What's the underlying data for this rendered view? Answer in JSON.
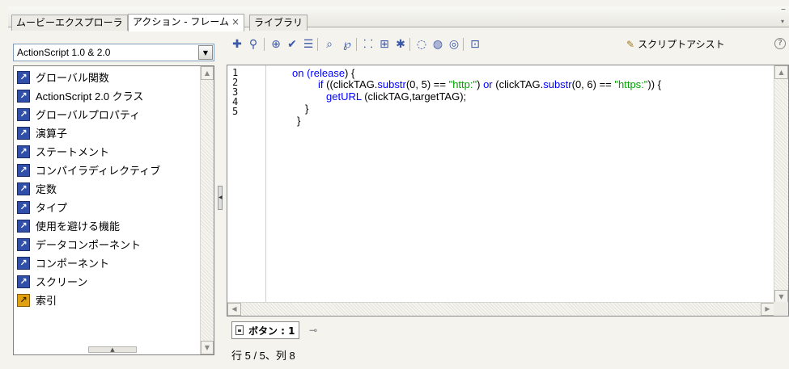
{
  "tabs": [
    {
      "label": "ムービーエクスプローラ",
      "active": false
    },
    {
      "label": "アクション - フレーム",
      "active": true,
      "close": "×"
    },
    {
      "label": "ライブラリ",
      "active": false
    }
  ],
  "left_panel": {
    "language_select": "ActionScript 1.0 & 2.0",
    "tree_items": [
      {
        "label": "グローバル関数",
        "icon": "book-icon"
      },
      {
        "label": "ActionScript 2.0 クラス",
        "icon": "book-icon"
      },
      {
        "label": "グローバルプロパティ",
        "icon": "book-icon"
      },
      {
        "label": "演算子",
        "icon": "book-icon"
      },
      {
        "label": "ステートメント",
        "icon": "book-icon"
      },
      {
        "label": "コンパイラディレクティブ",
        "icon": "book-icon"
      },
      {
        "label": "定数",
        "icon": "book-icon"
      },
      {
        "label": "タイプ",
        "icon": "book-icon"
      },
      {
        "label": "使用を避ける機能",
        "icon": "book-icon"
      },
      {
        "label": "データコンポーネント",
        "icon": "book-icon"
      },
      {
        "label": "コンポーネント",
        "icon": "book-icon"
      },
      {
        "label": "スクリーン",
        "icon": "book-icon"
      },
      {
        "label": "索引",
        "icon": "index-icon"
      }
    ]
  },
  "toolbar": {
    "buttons": [
      {
        "name": "add-statement",
        "glyph": "✚"
      },
      {
        "name": "find",
        "glyph": "⚲"
      },
      {
        "name": "target-path",
        "glyph": "⊕"
      },
      {
        "name": "check-syntax",
        "glyph": "✔"
      },
      {
        "name": "auto-format",
        "glyph": "☰"
      },
      {
        "name": "code-hint",
        "glyph": "⌕"
      },
      {
        "name": "debug-options",
        "glyph": "℘"
      },
      {
        "name": "collapse-between-braces",
        "glyph": "⸬"
      },
      {
        "name": "collapse-selection",
        "glyph": "⊞"
      },
      {
        "name": "expand-all",
        "glyph": "✱"
      },
      {
        "name": "apply-block-comment",
        "glyph": "◌"
      },
      {
        "name": "apply-line-comment",
        "glyph": "◍"
      },
      {
        "name": "remove-comment",
        "glyph": "◎"
      },
      {
        "name": "show-hide-toolbox",
        "glyph": "⊡"
      }
    ],
    "script_assist": "スクリプトアシスト",
    "help": "?"
  },
  "editor": {
    "line_numbers": [
      "1",
      "2",
      "3",
      "4",
      "5"
    ],
    "lines": [
      {
        "indent": 0,
        "parts": [
          {
            "t": "on (",
            "c": "kw"
          },
          {
            "t": "release",
            "c": "kw"
          },
          {
            "t": ") {",
            "c": ""
          }
        ]
      },
      {
        "indent": 1,
        "parts": [
          {
            "t": "if",
            "c": "kw"
          },
          {
            "t": " ((clickTAG.",
            "c": ""
          },
          {
            "t": "substr",
            "c": "kw"
          },
          {
            "t": "(0, 5) == ",
            "c": ""
          },
          {
            "t": "\"http:\"",
            "c": "str"
          },
          {
            "t": ") ",
            "c": ""
          },
          {
            "t": "or",
            "c": "kw"
          },
          {
            "t": " (clickTAG.",
            "c": ""
          },
          {
            "t": "substr",
            "c": "kw"
          },
          {
            "t": "(0, 6) == ",
            "c": ""
          },
          {
            "t": "\"https:\"",
            "c": "str"
          },
          {
            "t": ")) {",
            "c": ""
          }
        ]
      },
      {
        "indent": 2,
        "parts": [
          {
            "t": "getURL",
            "c": "kw"
          },
          {
            "t": " (clickTAG,targetTAG);",
            "c": ""
          }
        ]
      },
      {
        "indent": 3,
        "parts": [
          {
            "t": "}",
            "c": ""
          }
        ]
      },
      {
        "indent": 4,
        "parts": [
          {
            "t": "}",
            "c": ""
          }
        ]
      }
    ]
  },
  "script_tab": {
    "label": "ボタン : 1"
  },
  "status": {
    "text": "行 5 / 5、列 8"
  }
}
